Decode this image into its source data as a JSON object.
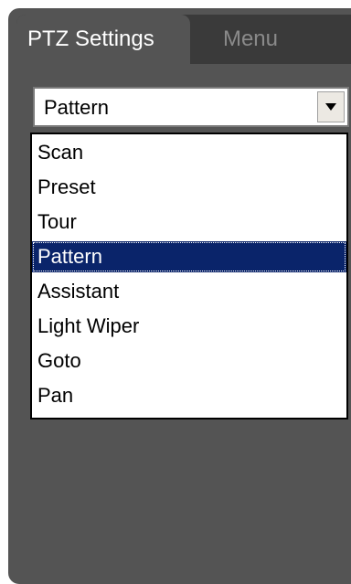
{
  "tabs": {
    "active": "PTZ Settings",
    "inactive": "Menu"
  },
  "dropdown": {
    "selected_value": "Pattern",
    "options": [
      "Scan",
      "Preset",
      "Tour",
      "Pattern",
      "Assistant",
      "Light Wiper",
      "Goto",
      "Pan"
    ],
    "highlighted_option": "Pattern"
  },
  "colors": {
    "panel_bg": "#545454",
    "tabbar_bg": "#3a3a3a",
    "selection_bg": "#0a246a"
  }
}
